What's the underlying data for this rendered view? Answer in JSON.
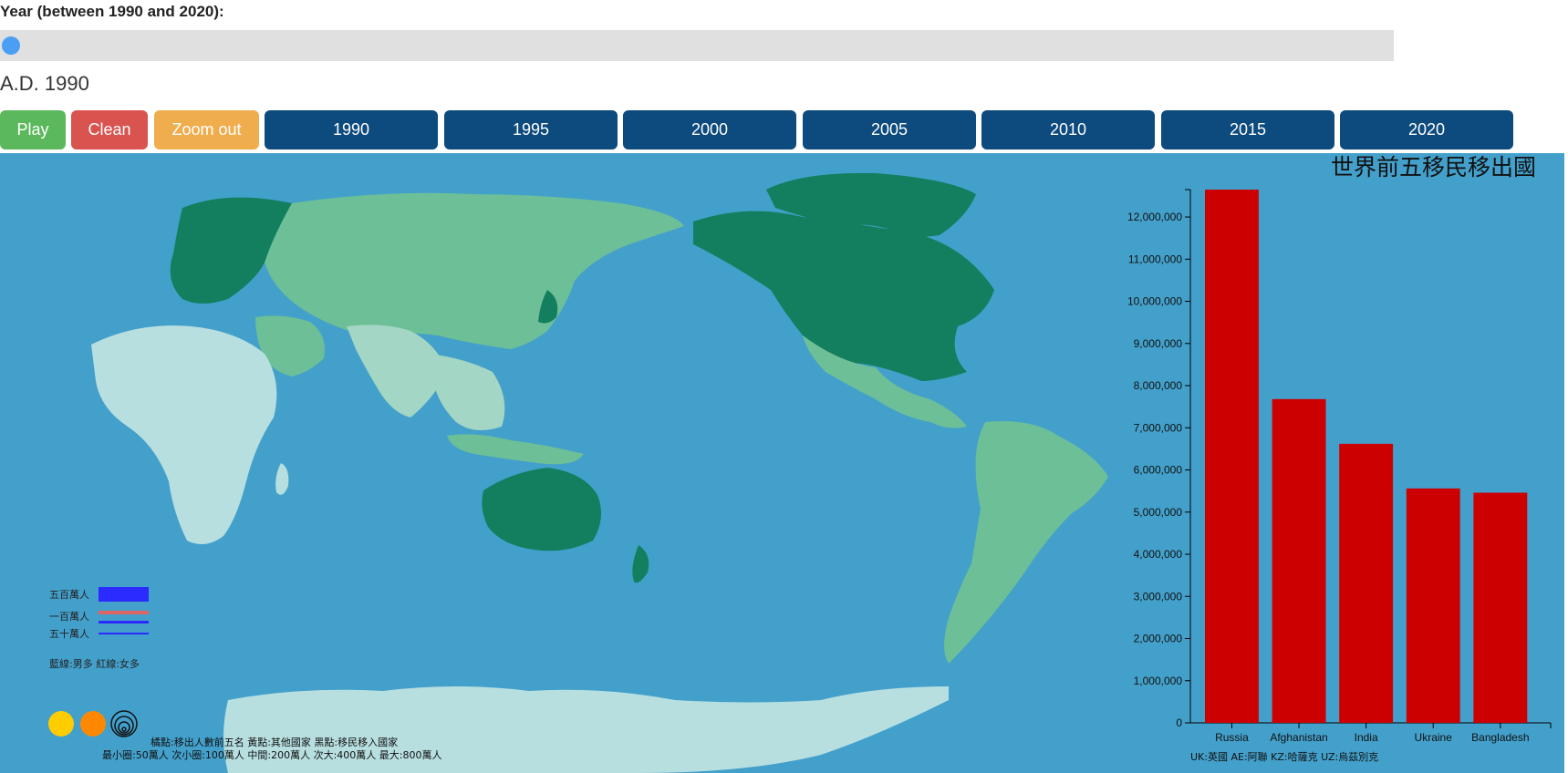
{
  "controls": {
    "year_prompt": "Year (between 1990 and 2020):",
    "year_display": "A.D. 1990",
    "slider_value": 1990,
    "slider_min": 1990,
    "slider_max": 2020,
    "play_label": "Play",
    "clean_label": "Clean",
    "zoom_label": "Zoom out",
    "year_buttons": [
      "1990",
      "1995",
      "2000",
      "2005",
      "2010",
      "2015",
      "2020"
    ]
  },
  "legend": {
    "line_5m": "五百萬人",
    "line_1m": "一百萬人",
    "line_500k": "五十萬人",
    "line_color_note": "藍線:男多 紅線:女多",
    "dot_note": "橘點:移出人數前五名 黃點:其他國家 黑點:移民移入國家",
    "circle_note": "最小圈:50萬人 次小圈:100萬人 中間:200萬人 次大:400萬人 最大:800萬人",
    "colors": {
      "yellow": "#ffcc00",
      "orange": "#ff8800",
      "blue": "#2b2bff",
      "red": "#e06666"
    }
  },
  "chart_data": {
    "type": "bar",
    "title": "世界前五移民移出國",
    "categories": [
      "Russia",
      "Afghanistan",
      "India",
      "Ukraine",
      "Bangladesh"
    ],
    "values": [
      12650000,
      7680000,
      6620000,
      5560000,
      5460000
    ],
    "ylim": [
      0,
      12650000
    ],
    "yticks": [
      0,
      1000000,
      2000000,
      3000000,
      4000000,
      5000000,
      6000000,
      7000000,
      8000000,
      9000000,
      10000000,
      11000000,
      12000000
    ],
    "bar_color": "#cc0000",
    "xlabel": "",
    "ylabel": "",
    "footnote": "UK:英國 AE:阿聯 KZ:哈薩克 UZ:烏茲別克"
  },
  "map": {
    "ocean_color": "#43a0cb",
    "land_colors": [
      "#b8dfe0",
      "#a3d6c4",
      "#6cbf97",
      "#137f5e"
    ]
  }
}
